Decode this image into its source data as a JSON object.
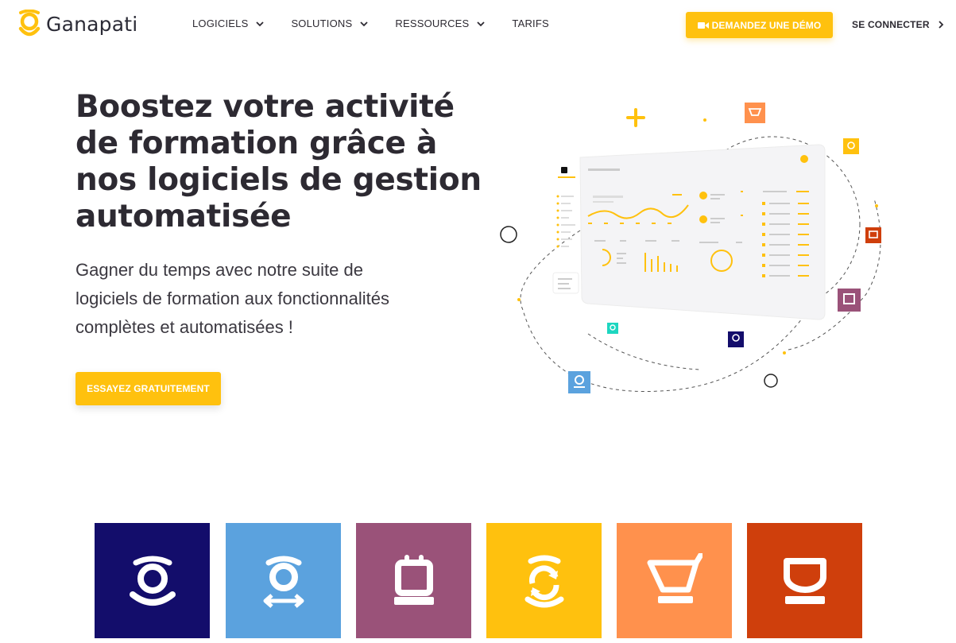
{
  "brand": {
    "name": "Ganapati",
    "logo_icon": "ganapati-g-logo-icon",
    "accent_color": "#ffc10e",
    "text_color": "#2d2a32"
  },
  "nav": {
    "items": [
      {
        "label": "LOGICIELS",
        "has_dropdown": true,
        "icon": "chevron-down-icon"
      },
      {
        "label": "SOLUTIONS",
        "has_dropdown": true,
        "icon": "chevron-down-icon"
      },
      {
        "label": "RESSOURCES",
        "has_dropdown": true,
        "icon": "chevron-down-icon"
      },
      {
        "label": "TARIFS",
        "has_dropdown": false
      }
    ],
    "demo_button": {
      "label": "DEMANDEZ UNE DÉMO",
      "icon": "video-camera-icon"
    },
    "login": {
      "label": "SE CONNECTER",
      "icon": "chevron-right-icon"
    }
  },
  "hero": {
    "title_lines": [
      "Boostez votre activité",
      "de formation grâce à",
      "nos logiciels de gestion",
      "automatisée"
    ],
    "subtitle_lines": [
      "Gagner du temps avec notre suite de",
      "logiciels de formation aux fonctionnalités",
      "complètes et automatisées !"
    ],
    "cta_label": "ESSAYEZ GRATUITEMENT",
    "illustration": "dashboard-illustration"
  },
  "products": [
    {
      "icon": "ganapati-g-icon",
      "color": "#130d6b"
    },
    {
      "icon": "g-arrows-exchange-icon",
      "color": "#5ba2de"
    },
    {
      "icon": "calendar-screen-icon",
      "color": "#9a5279"
    },
    {
      "icon": "g-refresh-icon",
      "color": "#ffc10e"
    },
    {
      "icon": "shopping-cart-icon",
      "color": "#ff914d"
    },
    {
      "icon": "computer-monitor-icon",
      "color": "#cf3f0c"
    }
  ]
}
